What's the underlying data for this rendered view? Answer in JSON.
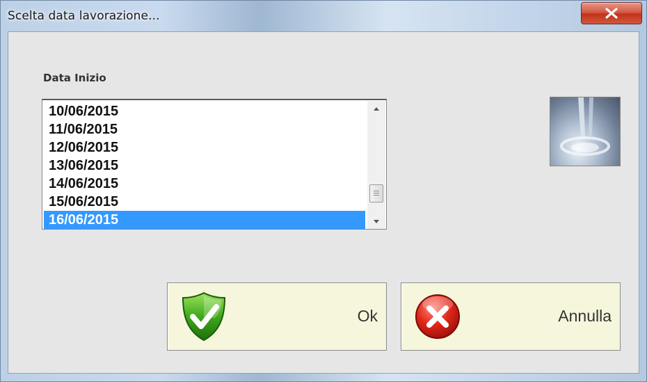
{
  "window": {
    "title": "Scelta data lavorazione...",
    "close_symbol": "x"
  },
  "form": {
    "date_label": "Data Inizio",
    "dates": [
      "10/06/2015",
      "11/06/2015",
      "12/06/2015",
      "13/06/2015",
      "14/06/2015",
      "15/06/2015",
      "16/06/2015"
    ],
    "selected_date": "16/06/2015"
  },
  "buttons": {
    "ok_label": "Ok",
    "cancel_label": "Annulla"
  },
  "icons": {
    "ok": "shield-check-icon",
    "cancel": "error-x-icon",
    "image": "milk-splash-image"
  },
  "colors": {
    "selection": "#3399ff",
    "button_bg": "#f6f6dc",
    "close_red": "#c0331b"
  }
}
